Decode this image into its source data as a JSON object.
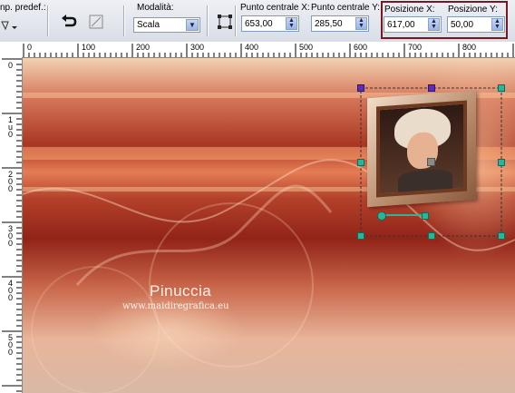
{
  "toolbar": {
    "preset_label": "np. predef.:",
    "mode_label": "Modalità:",
    "mode_value": "Scala",
    "center_x_label": "Punto centrale X:",
    "center_x_value": "653,00",
    "center_y_label": "Punto centrale Y:",
    "center_y_value": "285,50",
    "pos_x_label": "Posizione X:",
    "pos_x_value": "617,00",
    "pos_y_label": "Posizione Y:",
    "pos_y_value": "50,00"
  },
  "ruler": {
    "top_labels": [
      "0",
      "100",
      "200",
      "300",
      "400",
      "500",
      "600",
      "700",
      "800"
    ],
    "left_labels": [
      "0",
      "1\nu\n0",
      "2\n0\n0",
      "3\n0\n0",
      "4\n0\n0",
      "5\n0\n0"
    ]
  },
  "canvas": {
    "watermark_title": "Pinuccia",
    "watermark_url": "www.maidiregrafica.eu"
  },
  "colors": {
    "highlight_border": "#7a1820",
    "handle_color": "#29b59a",
    "corner_handle_color": "#5a2fb5"
  }
}
